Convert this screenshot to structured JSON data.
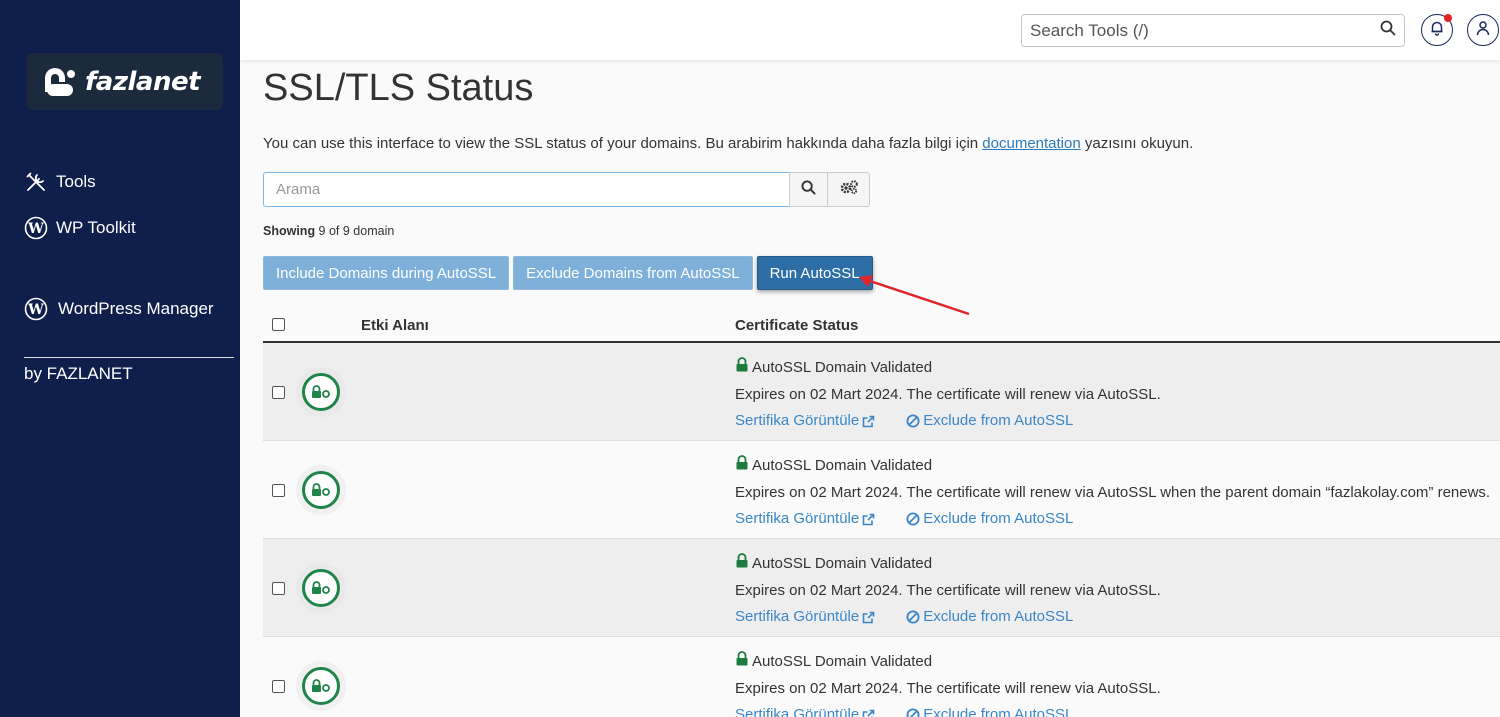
{
  "sidebar": {
    "logo_text": "fazlanet",
    "items": [
      {
        "label": "Tools",
        "icon": "tools-icon"
      },
      {
        "label": "WP Toolkit",
        "icon": "wordpress-icon"
      },
      {
        "label": "WordPress Manager",
        "label2": "by FAZLANET",
        "icon": "wordpress-icon"
      }
    ]
  },
  "topbar": {
    "search_placeholder": "Search Tools (/)",
    "notification_icon": "bell-icon",
    "user_icon": "user-icon"
  },
  "page": {
    "title": "SSL/TLS Status",
    "intro_before": "You can use this interface to view the SSL status of your domains. Bu arabirim hakkında daha fazla bilgi için ",
    "intro_link": "documentation",
    "intro_after": " yazısını okuyun."
  },
  "filter": {
    "placeholder": "Arama"
  },
  "showing": {
    "label": "Showing",
    "text": " 9 of 9 domain"
  },
  "actions": {
    "include": "Include Domains during AutoSSL",
    "exclude": "Exclude Domains from AutoSSL",
    "run": "Run AutoSSL"
  },
  "table": {
    "col_domain": "Etki Alanı",
    "col_status": "Certificate Status",
    "rows": [
      {
        "status": "AutoSSL Domain Validated",
        "expires": "Expires on 02 Mart 2024. The certificate will renew via AutoSSL.",
        "view": "Sertifika Görüntüle",
        "exclude": "Exclude from AutoSSL"
      },
      {
        "status": "AutoSSL Domain Validated",
        "expires": "Expires on 02 Mart 2024. The certificate will renew via AutoSSL when the parent domain “fazlakolay.com” renews.",
        "view": "Sertifika Görüntüle",
        "exclude": "Exclude from AutoSSL"
      },
      {
        "status": "AutoSSL Domain Validated",
        "expires": "Expires on 02 Mart 2024. The certificate will renew via AutoSSL.",
        "view": "Sertifika Görüntüle",
        "exclude": "Exclude from AutoSSL"
      },
      {
        "status": "AutoSSL Domain Validated",
        "expires": "Expires on 02 Mart 2024. The certificate will renew via AutoSSL.",
        "view": "Sertifika Görüntüle",
        "exclude": "Exclude from AutoSSL"
      }
    ]
  },
  "colors": {
    "sidebar_bg": "#0f1f4b",
    "link": "#3a86c8",
    "primary": "#2e6ea6",
    "success": "#1e8449",
    "annotation_arrow": "#e0242a"
  }
}
